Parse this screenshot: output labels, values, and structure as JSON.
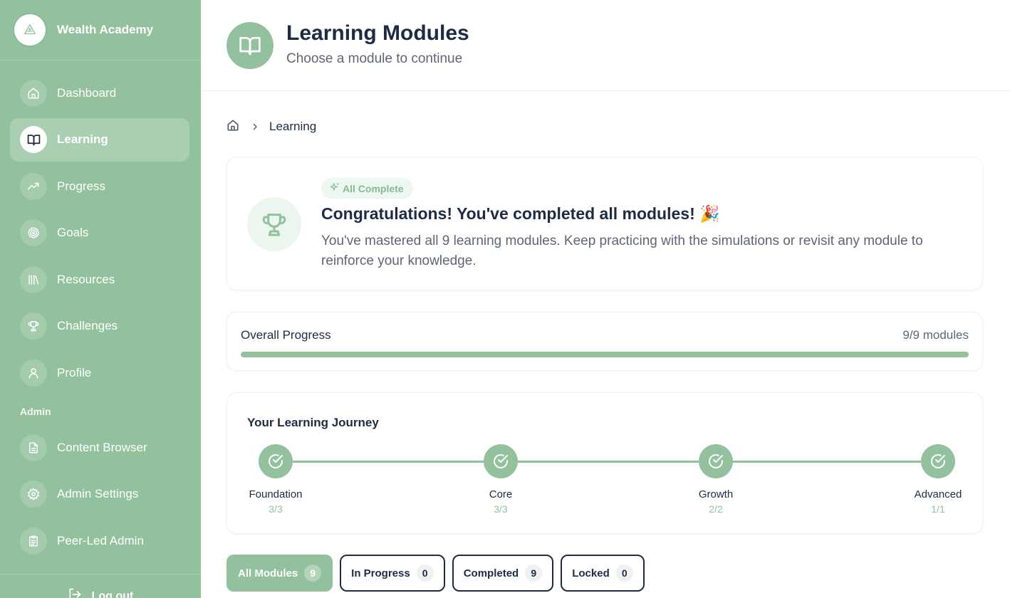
{
  "brand": {
    "name": "Wealth Academy"
  },
  "colors": {
    "primary": "#93c19d",
    "text": "#1f2b45",
    "muted": "#5d6675"
  },
  "sidebar": {
    "items": [
      {
        "label": "Dashboard",
        "icon": "home-icon"
      },
      {
        "label": "Learning",
        "icon": "book-icon",
        "active": true
      },
      {
        "label": "Progress",
        "icon": "trending-up-icon"
      },
      {
        "label": "Goals",
        "icon": "target-icon"
      },
      {
        "label": "Resources",
        "icon": "library-icon"
      },
      {
        "label": "Challenges",
        "icon": "trophy-icon"
      },
      {
        "label": "Profile",
        "icon": "user-icon"
      }
    ],
    "admin_section": "Admin",
    "admin_items": [
      {
        "label": "Content Browser",
        "icon": "file-text-icon"
      },
      {
        "label": "Admin Settings",
        "icon": "gear-icon"
      },
      {
        "label": "Peer-Led Admin",
        "icon": "clipboard-icon"
      }
    ],
    "logout": "Log out"
  },
  "header": {
    "title": "Learning Modules",
    "subtitle": "Choose a module to continue"
  },
  "breadcrumb": {
    "current": "Learning"
  },
  "congrats": {
    "badge": "All Complete",
    "title": "Congratulations! You've completed all modules! 🎉",
    "text": "You've mastered all 9 learning modules. Keep practicing with the simulations or revisit any module to reinforce your knowledge."
  },
  "overall": {
    "label": "Overall Progress",
    "value": "9/9 modules",
    "fraction": 1.0
  },
  "journey": {
    "title": "Your Learning Journey",
    "steps": [
      {
        "name": "Foundation",
        "count": "3/3"
      },
      {
        "name": "Core",
        "count": "3/3"
      },
      {
        "name": "Growth",
        "count": "2/2"
      },
      {
        "name": "Advanced",
        "count": "1/1"
      }
    ]
  },
  "filters": [
    {
      "label": "All Modules",
      "count": "9",
      "active": true
    },
    {
      "label": "In Progress",
      "count": "0"
    },
    {
      "label": "Completed",
      "count": "9"
    },
    {
      "label": "Locked",
      "count": "0"
    }
  ]
}
